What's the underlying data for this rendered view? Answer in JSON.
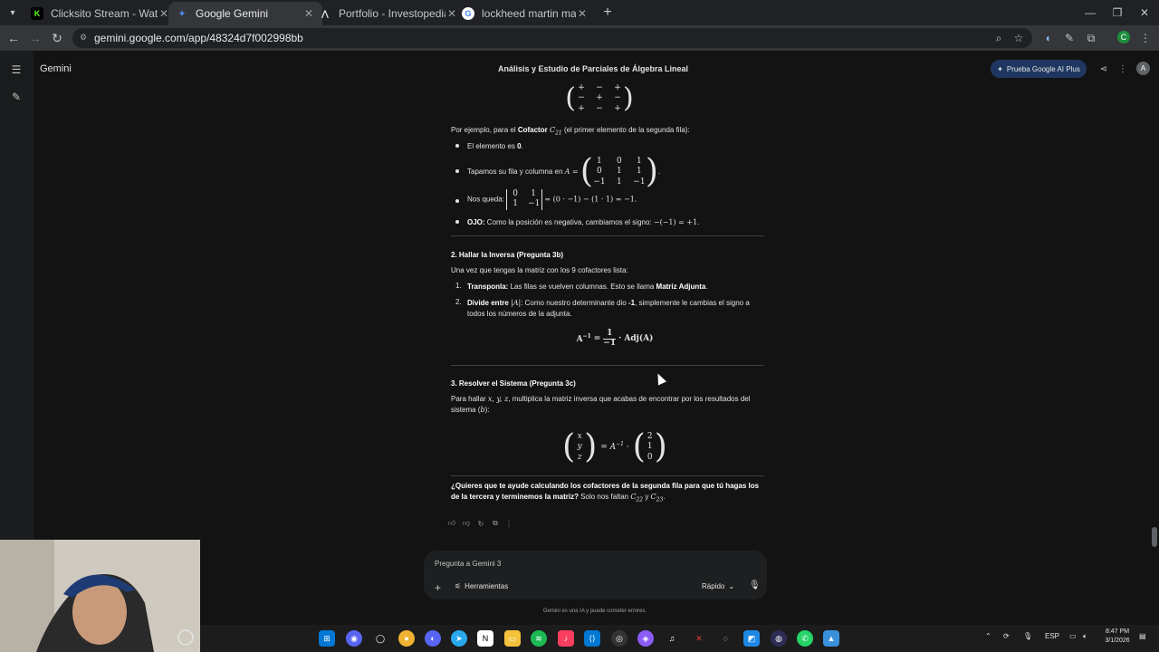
{
  "browser": {
    "tabs": [
      {
        "title": "Clicksito Stream - Watch Live o",
        "favicon": "K",
        "color": "#53fc18",
        "active": false
      },
      {
        "title": "Google Gemini",
        "favicon": "✦",
        "color": "#4f8df5",
        "active": true
      },
      {
        "title": "Portfolio - Investopedia Stock S",
        "favicon": "⋀",
        "color": "#e8eaed",
        "active": false
      },
      {
        "title": "lockheed martin market code -",
        "favicon": "G",
        "color": "#ffffff",
        "active": false
      }
    ],
    "url": "gemini.google.com/app/48324d7f002998bb",
    "profile_initial": "C"
  },
  "app": {
    "name": "Gemini",
    "conversation_title": "Análisis y Estudio de Parciales de Álgebra Lineal",
    "upgrade_label": "Prueba Google AI Plus",
    "avatar_initial": "A"
  },
  "response": {
    "sign_matrix": [
      [
        "+",
        "−",
        "+"
      ],
      [
        "−",
        "+",
        "−"
      ],
      [
        "+",
        "−",
        "+"
      ]
    ],
    "example_intro_1": "Por ejemplo, para el ",
    "example_intro_bold": "Cofactor",
    "example_intro_sym": "C",
    "example_intro_sub": "21",
    "example_intro_2": " (el primer elemento de la segunda fila):",
    "b1_text": "El elemento es ",
    "b1_bold": "0",
    "b2_text": "Tapamos su fila y columna en ",
    "b2_sym": "A =",
    "matrix_A": [
      [
        "1",
        "0",
        "1"
      ],
      [
        "0",
        "1",
        "1"
      ],
      [
        "−1",
        "1",
        "−1"
      ]
    ],
    "b3_text": "Nos queda: ",
    "minor": [
      [
        "0",
        "1"
      ],
      [
        "1",
        "−1"
      ]
    ],
    "b3_result": "= (0 · −1) − (1 · 1) = −1.",
    "b4_bold": "OJO:",
    "b4_text": " Como la posición es negativa, cambiamos el signo: ",
    "b4_math": "−(−1) = +1",
    "s2_heading": "2. Hallar la Inversa (Pregunta 3b)",
    "s2_intro": "Una vez que tengas la matriz con los 9 cofactores lista:",
    "s2_i1_bold": "Transponla:",
    "s2_i1_text": " Las filas se vuelven columnas. Esto se llama ",
    "s2_i1_bold2": "Matriz Adjunta",
    "s2_i2_bold": "Divide entre",
    "s2_i2_math": "|A|",
    "s2_i2_text_1": ": Como nuestro determinante dio ",
    "s2_i2_bold2": "-1",
    "s2_i2_text_2": ", simplemente le cambias el signo a todos los números de la adjunta.",
    "s2_formula_left": "A",
    "s2_formula_sup": "−1",
    "s2_formula_num": "1",
    "s2_formula_den": "−1",
    "s2_formula_right": "· Adj(A)",
    "s3_heading": "3. Resolver el Sistema (Pregunta 3c)",
    "s3_text_1": "Para hallar ",
    "s3_math": "x, y, z",
    "s3_text_2": ", multiplica la matriz inversa que acabas de encontrar por los resultados del sistema (",
    "s3_b": "b",
    "s3_text_3": "):",
    "s3_vec_xyz": [
      "x",
      "y",
      "z"
    ],
    "s3_mid": "= A",
    "s3_mid_sup": "−1",
    "s3_dot": "·",
    "s3_vec_b": [
      "2",
      "1",
      "0"
    ],
    "closing_bold": "¿Quieres que te ayude calculando los cofactores de la segunda fila para que tú hagas los de la tercera y terminemos la matriz?",
    "closing_text": " Solo nos faltan ",
    "closing_c22": "C",
    "closing_c22_sub": "22",
    "closing_y": " y ",
    "closing_c23": "C",
    "closing_c23_sub": "23",
    "closing_end": "."
  },
  "input": {
    "placeholder": "Pregunta a Gemini 3",
    "tools_label": "Herramientas",
    "mode_label": "Rápido",
    "disclaimer": "Gemini es una IA y puede cometer errores."
  },
  "taskbar": {
    "language": "ESP",
    "time": "8:47 PM",
    "date": "3/1/2026"
  }
}
